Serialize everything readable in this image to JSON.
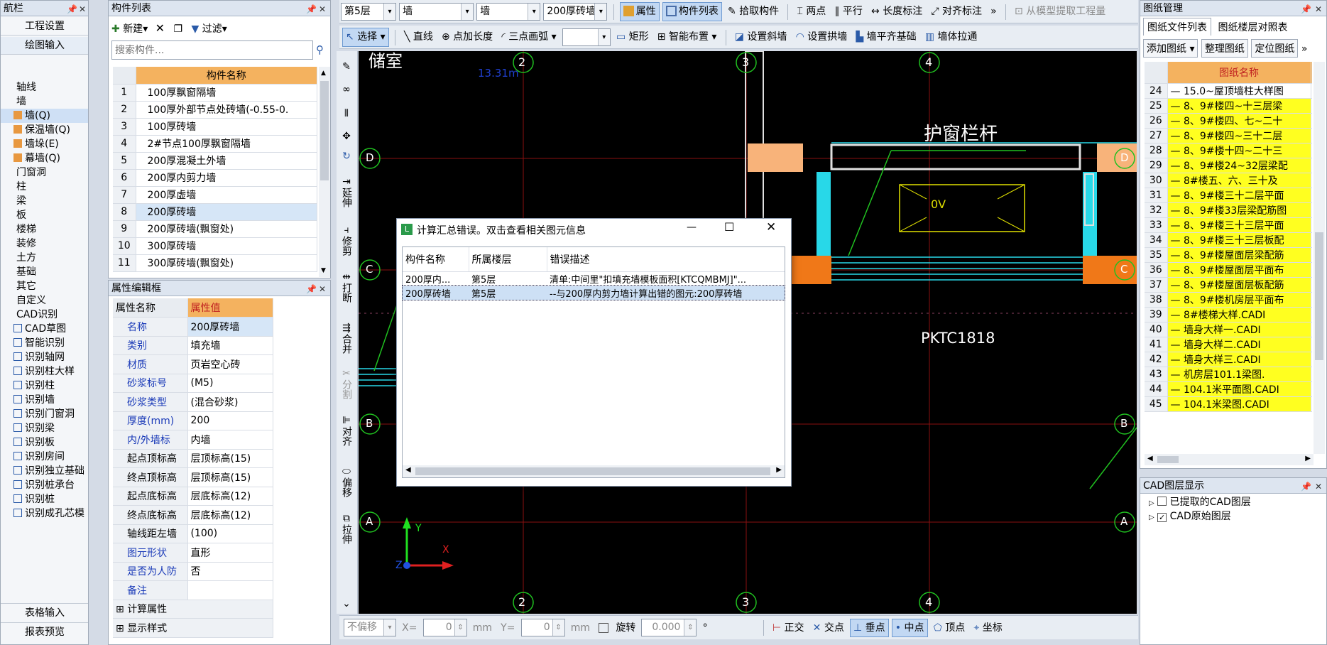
{
  "nav": {
    "title": "航栏",
    "items_top": [
      "工程设置",
      "绘图输入"
    ],
    "items_bottom": [
      "表格输入",
      "报表预览"
    ],
    "tree": [
      {
        "text": "轴线",
        "level": 0,
        "icon": "axis-icon"
      },
      {
        "text": "墙",
        "level": 0,
        "icon": "none"
      },
      {
        "text": "墙(Q)",
        "level": 1,
        "icon": "wall-icon",
        "selected": true
      },
      {
        "text": "保温墙(Q)",
        "level": 1,
        "icon": "wall-icon"
      },
      {
        "text": "墙垛(E)",
        "level": 1,
        "icon": "wall-icon"
      },
      {
        "text": "幕墙(Q)",
        "level": 1,
        "icon": "wall-icon"
      },
      {
        "text": "门窗洞",
        "level": 0,
        "icon": "none"
      },
      {
        "text": "柱",
        "level": 0,
        "icon": "none"
      },
      {
        "text": "梁",
        "level": 0,
        "icon": "none"
      },
      {
        "text": "板",
        "level": 0,
        "icon": "none"
      },
      {
        "text": "楼梯",
        "level": 0,
        "icon": "none"
      },
      {
        "text": "装修",
        "level": 0,
        "icon": "none"
      },
      {
        "text": "土方",
        "level": 0,
        "icon": "none"
      },
      {
        "text": "基础",
        "level": 0,
        "icon": "none"
      },
      {
        "text": "其它",
        "level": 0,
        "icon": "none"
      },
      {
        "text": "自定义",
        "level": 0,
        "icon": "none"
      },
      {
        "text": "CAD识别",
        "level": 0,
        "icon": "none"
      },
      {
        "text": "CAD草图",
        "level": 1,
        "icon": "cad-icon"
      },
      {
        "text": "智能识别",
        "level": 1,
        "icon": "cad-icon"
      },
      {
        "text": "识别轴网",
        "level": 1,
        "icon": "cad-icon"
      },
      {
        "text": "识别柱大样",
        "level": 1,
        "icon": "cad-icon"
      },
      {
        "text": "识别柱",
        "level": 1,
        "icon": "cad-icon"
      },
      {
        "text": "识别墙",
        "level": 1,
        "icon": "cad-icon"
      },
      {
        "text": "识别门窗洞",
        "level": 1,
        "icon": "cad-icon"
      },
      {
        "text": "识别梁",
        "level": 1,
        "icon": "cad-icon"
      },
      {
        "text": "识别板",
        "level": 1,
        "icon": "cad-icon"
      },
      {
        "text": "识别房间",
        "level": 1,
        "icon": "cad-icon"
      },
      {
        "text": "识别独立基础",
        "level": 1,
        "icon": "cad-icon"
      },
      {
        "text": "识别桩承台",
        "level": 1,
        "icon": "cad-icon"
      },
      {
        "text": "识别桩",
        "level": 1,
        "icon": "cad-icon"
      },
      {
        "text": "识别成孔芯模",
        "level": 1,
        "icon": "cad-icon"
      }
    ]
  },
  "complist": {
    "title": "构件列表",
    "new_label": "新建",
    "filter_label": "过滤",
    "search_placeholder": "搜索构件...",
    "header": "构件名称",
    "rows": [
      [
        "1",
        "100厚飘窗隔墙"
      ],
      [
        "2",
        "100厚外部节点处砖墙(-0.55-0."
      ],
      [
        "3",
        "100厚砖墙"
      ],
      [
        "4",
        "2#节点100厚飘窗隔墙"
      ],
      [
        "5",
        "200厚混凝土外墙"
      ],
      [
        "6",
        "200厚内剪力墙"
      ],
      [
        "7",
        "200厚虚墙"
      ],
      [
        "8",
        "200厚砖墙"
      ],
      [
        "9",
        "200厚砖墙(飘窗处)"
      ],
      [
        "10",
        "300厚砖墙"
      ],
      [
        "11",
        "300厚砖墙(飘窗处)"
      ]
    ],
    "selected_index": 7
  },
  "props": {
    "title": "属性编辑框",
    "col_name": "属性名称",
    "col_value": "属性值",
    "rows": [
      [
        "名称",
        "200厚砖墙",
        true
      ],
      [
        "类别",
        "填充墙",
        true
      ],
      [
        "材质",
        "页岩空心砖",
        true
      ],
      [
        "砂浆标号",
        "(M5)",
        true
      ],
      [
        "砂浆类型",
        "(混合砂浆)",
        true
      ],
      [
        "厚度(mm)",
        "200",
        true
      ],
      [
        "内/外墙标",
        "内墙",
        true
      ],
      [
        "起点顶标高",
        "层顶标高(15)",
        false
      ],
      [
        "终点顶标高",
        "层顶标高(15)",
        false
      ],
      [
        "起点底标高",
        "层底标高(12)",
        false
      ],
      [
        "终点底标高",
        "层底标高(12)",
        false
      ],
      [
        "轴线距左墙",
        "(100)",
        false
      ],
      [
        "图元形状",
        "直形",
        true
      ],
      [
        "是否为人防",
        "否",
        true
      ],
      [
        "备注",
        "",
        true
      ]
    ],
    "groups": [
      "计算属性",
      "显示样式"
    ]
  },
  "toolbar1": {
    "floor": "第5层",
    "type1": "墙",
    "type2": "墙",
    "comp": "200厚砖墙",
    "btns": [
      "属性",
      "构件列表",
      "拾取构件",
      "两点",
      "平行",
      "长度标注",
      "对齐标注",
      "从模型提取工程量"
    ]
  },
  "toolbar2": {
    "btns": [
      "选择",
      "直线",
      "点加长度",
      "三点画弧",
      "矩形",
      "智能布置",
      "设置斜墙",
      "设置拱墙",
      "墙平齐基础",
      "墙体拉通"
    ]
  },
  "vtools": [
    "延伸",
    "修剪",
    "打断",
    "合并",
    "分割",
    "对齐",
    "偏移",
    "拉伸"
  ],
  "canvas": {
    "texts": [
      "护窗栏杆",
      "PKTC1818",
      "13.31m",
      "储室",
      "0V"
    ],
    "axes_top": [
      "2",
      "3",
      "4"
    ],
    "axes_bottom": [
      "2",
      "3",
      "4"
    ],
    "rows_left": [
      "D",
      "C",
      "B",
      "A"
    ],
    "rows_right": [
      "D",
      "C",
      "B",
      "A"
    ],
    "x_label": "X",
    "y_label": "Y",
    "z_label": "Z"
  },
  "dialog": {
    "title": "计算汇总错误。双击查看相关图元信息",
    "headers": [
      "构件名称",
      "所属楼层",
      "错误描述"
    ],
    "rows": [
      [
        "200厚内...",
        "第5层",
        "清单:中间里\"扣填充墙模板面积[KTCQMBMJ]\"..."
      ],
      [
        "200厚砖墙",
        "第5层",
        "--与200厚内剪力墙计算出错的图元:200厚砖墙"
      ]
    ]
  },
  "drawings": {
    "title": "图纸管理",
    "tabs": [
      "图纸文件列表",
      "图纸楼层对照表"
    ],
    "btns": [
      "添加图纸",
      "整理图纸",
      "定位图纸"
    ],
    "header": "图纸名称",
    "rows": [
      [
        "24",
        "15.0~屋顶墙柱大样图",
        false
      ],
      [
        "25",
        "8、9#楼四~十三层梁",
        true
      ],
      [
        "26",
        "8、9#楼四、七~二十",
        true
      ],
      [
        "27",
        "8、9#楼四~三十二层",
        true
      ],
      [
        "28",
        "8、9#楼十四~二十三",
        true
      ],
      [
        "29",
        "8、9#楼24~32层梁配",
        true
      ],
      [
        "30",
        "8#楼五、六、三十及",
        true
      ],
      [
        "31",
        "8、9#楼三十二层平面",
        true
      ],
      [
        "32",
        "8、9#楼33层梁配筋图",
        true
      ],
      [
        "33",
        "8、9#楼三十三层平面",
        true
      ],
      [
        "34",
        "8、9#楼三十三层板配",
        true
      ],
      [
        "35",
        "8、9#楼屋面层梁配筋",
        true
      ],
      [
        "36",
        "8、9#楼屋面层平面布",
        true
      ],
      [
        "37",
        "8、9#楼屋面层板配筋",
        true
      ],
      [
        "38",
        "8、9#楼机房层平面布",
        true
      ],
      [
        "39",
        "8#楼梯大样.CADI",
        true
      ],
      [
        "40",
        "墙身大样一.CADI",
        true
      ],
      [
        "41",
        "墙身大样二.CADI",
        true
      ],
      [
        "42",
        "墙身大样三.CADI",
        true
      ],
      [
        "43",
        "机房层101.1梁图.",
        true
      ],
      [
        "44",
        "104.1米平面图.CADI",
        true
      ],
      [
        "45",
        "104.1米梁图.CADI",
        true
      ]
    ]
  },
  "layers": {
    "title": "CAD图层显示",
    "items": [
      "已提取的CAD图层",
      "CAD原始图层"
    ],
    "checked": [
      false,
      true
    ]
  },
  "status": {
    "offset": "不偏移",
    "x": "0",
    "y": "0",
    "unit": "mm",
    "rotate": "旋转",
    "angle": "0.000",
    "deg": "°",
    "snap": [
      "正交",
      "交点",
      "垂点",
      "中点",
      "顶点",
      "坐标"
    ]
  }
}
